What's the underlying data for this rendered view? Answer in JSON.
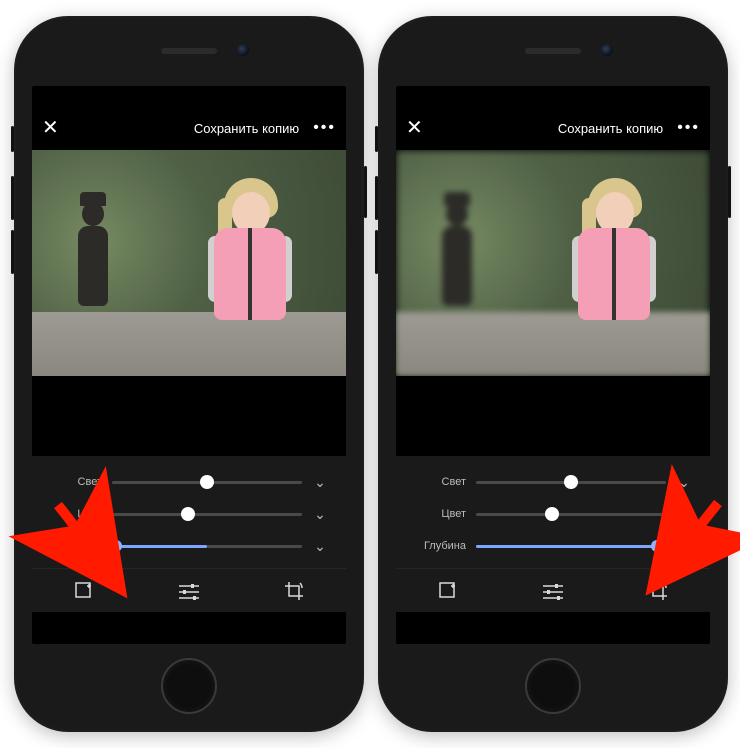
{
  "header": {
    "close_label": "✕",
    "save_label": "Сохранить копию",
    "more_label": "•••"
  },
  "sliders": {
    "light": {
      "label": "Свет",
      "value": 50
    },
    "color": {
      "label": "Цвет",
      "value": 40
    },
    "depth_left": {
      "label": "Глубина",
      "value": 2
    },
    "depth_right": {
      "label": "Глубина",
      "value": 95
    }
  },
  "toolbar": {
    "effects_icon": "effects-icon",
    "adjust_icon": "adjust-icon",
    "crop_icon": "crop-rotate-icon"
  },
  "annotation_color": "#ff1a00"
}
